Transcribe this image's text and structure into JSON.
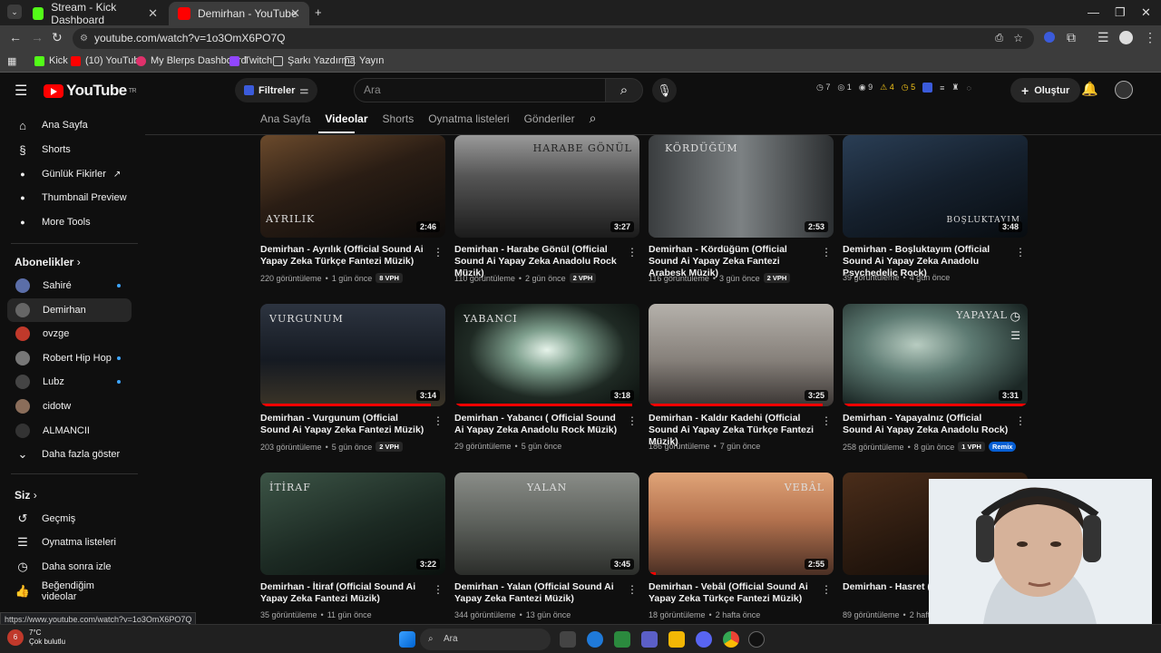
{
  "browser": {
    "tabs": [
      {
        "label": "Stream - Kick Dashboard",
        "color": "#53fc18"
      },
      {
        "label": "Demirhan - YouTube",
        "color": "#ff0000"
      }
    ],
    "url": "youtube.com/watch?v=1o3OmX6PO7Q",
    "bookmarks": [
      "Kick",
      "(10) YouTube",
      "My Blerps Dashboard",
      "Twitch",
      "Şarkı Yazdırma",
      "Yayın"
    ]
  },
  "masthead": {
    "logo": "YouTube",
    "region": "TR",
    "filters_label": "Filtreler",
    "search_placeholder": "Ara",
    "stats": [
      "7",
      "1",
      "9",
      "4",
      "5"
    ],
    "create_label": "Oluştur"
  },
  "channel_tabs": [
    "Ana Sayfa",
    "Videolar",
    "Shorts",
    "Oynatma listeleri",
    "Gönderiler"
  ],
  "sidebar": {
    "main": [
      "Ana Sayfa",
      "Shorts",
      "Günlük Fikirler",
      "Thumbnail Preview",
      "More Tools"
    ],
    "subs_header": "Abonelikler",
    "subs": [
      "Sahiré",
      "Demirhan",
      "ovzge",
      "Robert Hip Hop",
      "Lubz",
      "cidotw",
      "ALMANCII"
    ],
    "more": "Daha fazla göster",
    "you_header": "Siz",
    "you": [
      "Geçmiş",
      "Oynatma listeleri",
      "Daha sonra izle",
      "Beğendiğim videolar"
    ]
  },
  "videos": [
    {
      "title": "Demirhan - Ayrılık (Official Sound Ai Yapay Zeka Türkçe Fantezi Müzik)",
      "views": "220 görüntüleme",
      "age": "1 gün önce",
      "vph": "8 VPH",
      "duration": "2:46",
      "overlay": "AYRILIK",
      "remix": ""
    },
    {
      "title": "Demirhan - Harabe Gönül (Official Sound Ai Yapay Zeka Anadolu Rock Müzik)",
      "views": "110 görüntüleme",
      "age": "2 gün önce",
      "vph": "2 VPH",
      "duration": "3:27",
      "overlay": "HARABE GÖNÜL",
      "remix": ""
    },
    {
      "title": "Demirhan - Kördüğüm (Official Sound Ai Yapay Zeka Fantezi Arabesk Müzik)",
      "views": "116 görüntüleme",
      "age": "3 gün önce",
      "vph": "2 VPH",
      "duration": "2:53",
      "overlay": "KÖRDÜĞÜM",
      "remix": ""
    },
    {
      "title": "Demirhan - Boşluktayım (Official Sound Ai Yapay Zeka Anadolu Psychedelic Rock)",
      "views": "39 görüntüleme",
      "age": "4 gün önce",
      "vph": "",
      "duration": "3:48",
      "overlay": "BOŞLUKTAYIM",
      "remix": ""
    },
    {
      "title": "Demirhan - Vurgunum (Official Sound Ai Yapay Zeka Fantezi Müzik)",
      "views": "203 görüntüleme",
      "age": "5 gün önce",
      "vph": "2 VPH",
      "duration": "3:14",
      "overlay": "VURGUNUM",
      "remix": ""
    },
    {
      "title": "Demirhan - Yabancı ( Official Sound Ai Yapay Zeka Anadolu Rock Müzik)",
      "views": "29 görüntüleme",
      "age": "5 gün önce",
      "vph": "",
      "duration": "3:18",
      "overlay": "YABANCI",
      "remix": ""
    },
    {
      "title": "Demirhan - Kaldır Kadehi (Official Sound Ai Yapay Zeka Türkçe Fantezi Müzik)",
      "views": "186 görüntüleme",
      "age": "7 gün önce",
      "vph": "",
      "duration": "3:25",
      "overlay": "",
      "remix": ""
    },
    {
      "title": "Demirhan - Yapayalnız (Official Sound Ai Yapay Zeka Anadolu Rock)",
      "views": "258 görüntüleme",
      "age": "8 gün önce",
      "vph": "1 VPH",
      "duration": "3:31",
      "overlay": "YAPAYAL",
      "remix": "Remix"
    },
    {
      "title": "Demirhan - İtiraf (Official Sound Ai Yapay Zeka Fantezi Müzik)",
      "views": "35 görüntüleme",
      "age": "11 gün önce",
      "vph": "",
      "duration": "3:22",
      "overlay": "İTİRAF",
      "remix": ""
    },
    {
      "title": "Demirhan - Yalan (Official Sound Ai Yapay Zeka Fantezi Müzik)",
      "views": "344 görüntüleme",
      "age": "13 gün önce",
      "vph": "",
      "duration": "3:45",
      "overlay": "YALAN",
      "remix": ""
    },
    {
      "title": "Demirhan - Vebâl (Official Sound Ai Yapay Zeka Türkçe Fantezi Müzik)",
      "views": "18 görüntüleme",
      "age": "2 hafta önce",
      "vph": "",
      "duration": "2:55",
      "overlay": "VEBÂL",
      "remix": ""
    },
    {
      "title": "Demirhan - Hasret (Offi Zeka Fantezi)",
      "views": "89 görüntüleme",
      "age": "2 hafta ö",
      "vph": "",
      "duration": "",
      "overlay": "",
      "remix": ""
    }
  ],
  "status_link": "https://www.youtube.com/watch?v=1o3OmX6PO7Q",
  "weather": {
    "temp": "7°C",
    "desc": "Çok bulutlu"
  },
  "taskbar_search": "Ara"
}
